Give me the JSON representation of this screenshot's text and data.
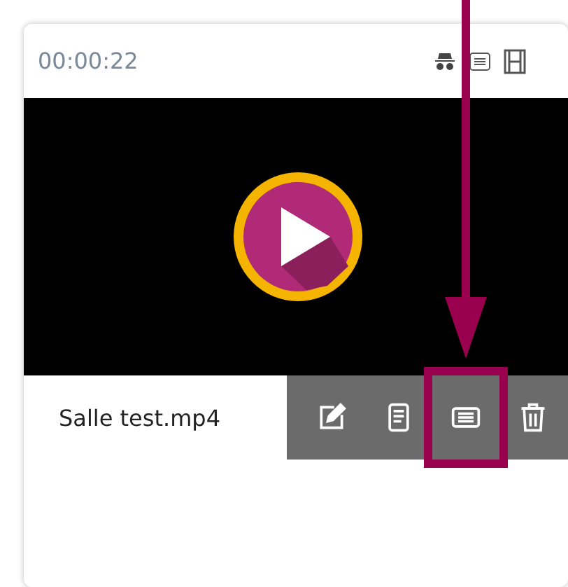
{
  "card": {
    "duration": "00:00:22",
    "filename": "Salle test.mp4",
    "actions": [
      {
        "kind": "edit",
        "highlighted": false
      },
      {
        "kind": "document",
        "highlighted": false
      },
      {
        "kind": "list",
        "highlighted": true
      },
      {
        "kind": "delete",
        "highlighted": false
      }
    ]
  }
}
